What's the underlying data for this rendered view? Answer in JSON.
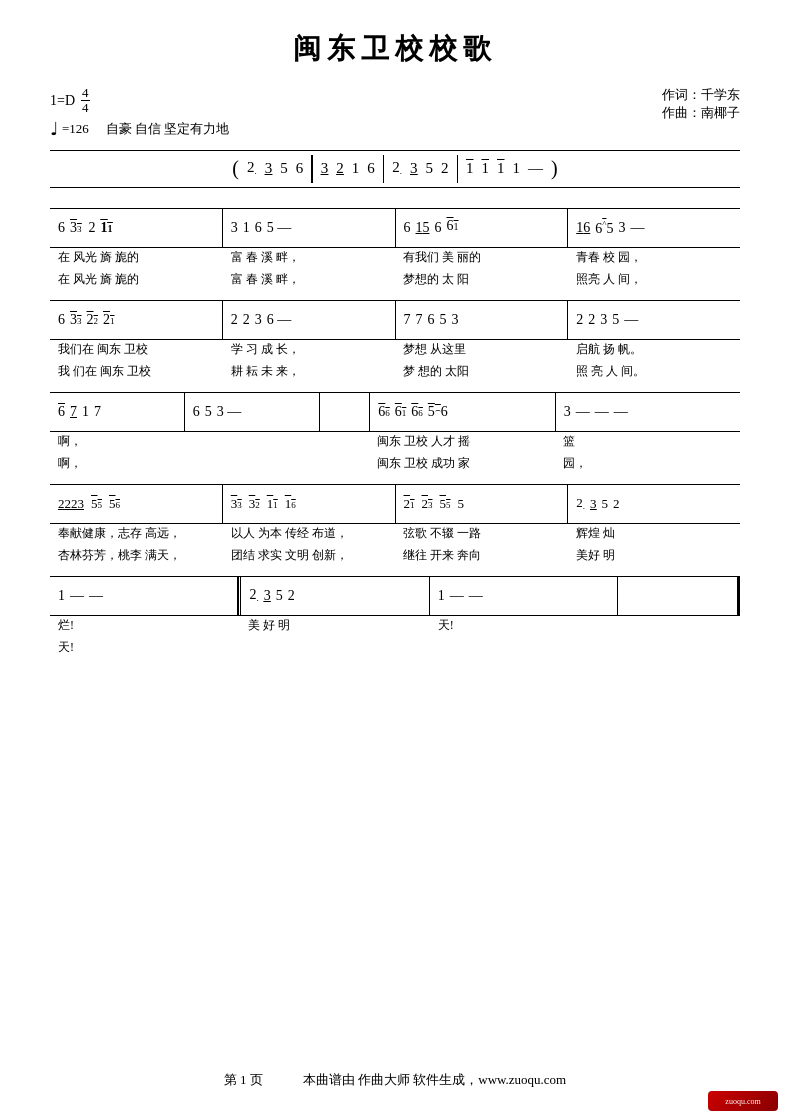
{
  "title": "闽东卫校校歌",
  "meta": {
    "key": "1=D",
    "time_num": "4",
    "time_den": "4",
    "tempo_symbol": "♩=126",
    "tempo_text": "自豪 自信 坚定有力地",
    "lyricist": "作词：千学东",
    "composer": "作曲：南椰子"
  },
  "footer": {
    "page": "第 1 页",
    "credit": "本曲谱由 作曲大师 软件生成，www.zuoqu.com"
  }
}
